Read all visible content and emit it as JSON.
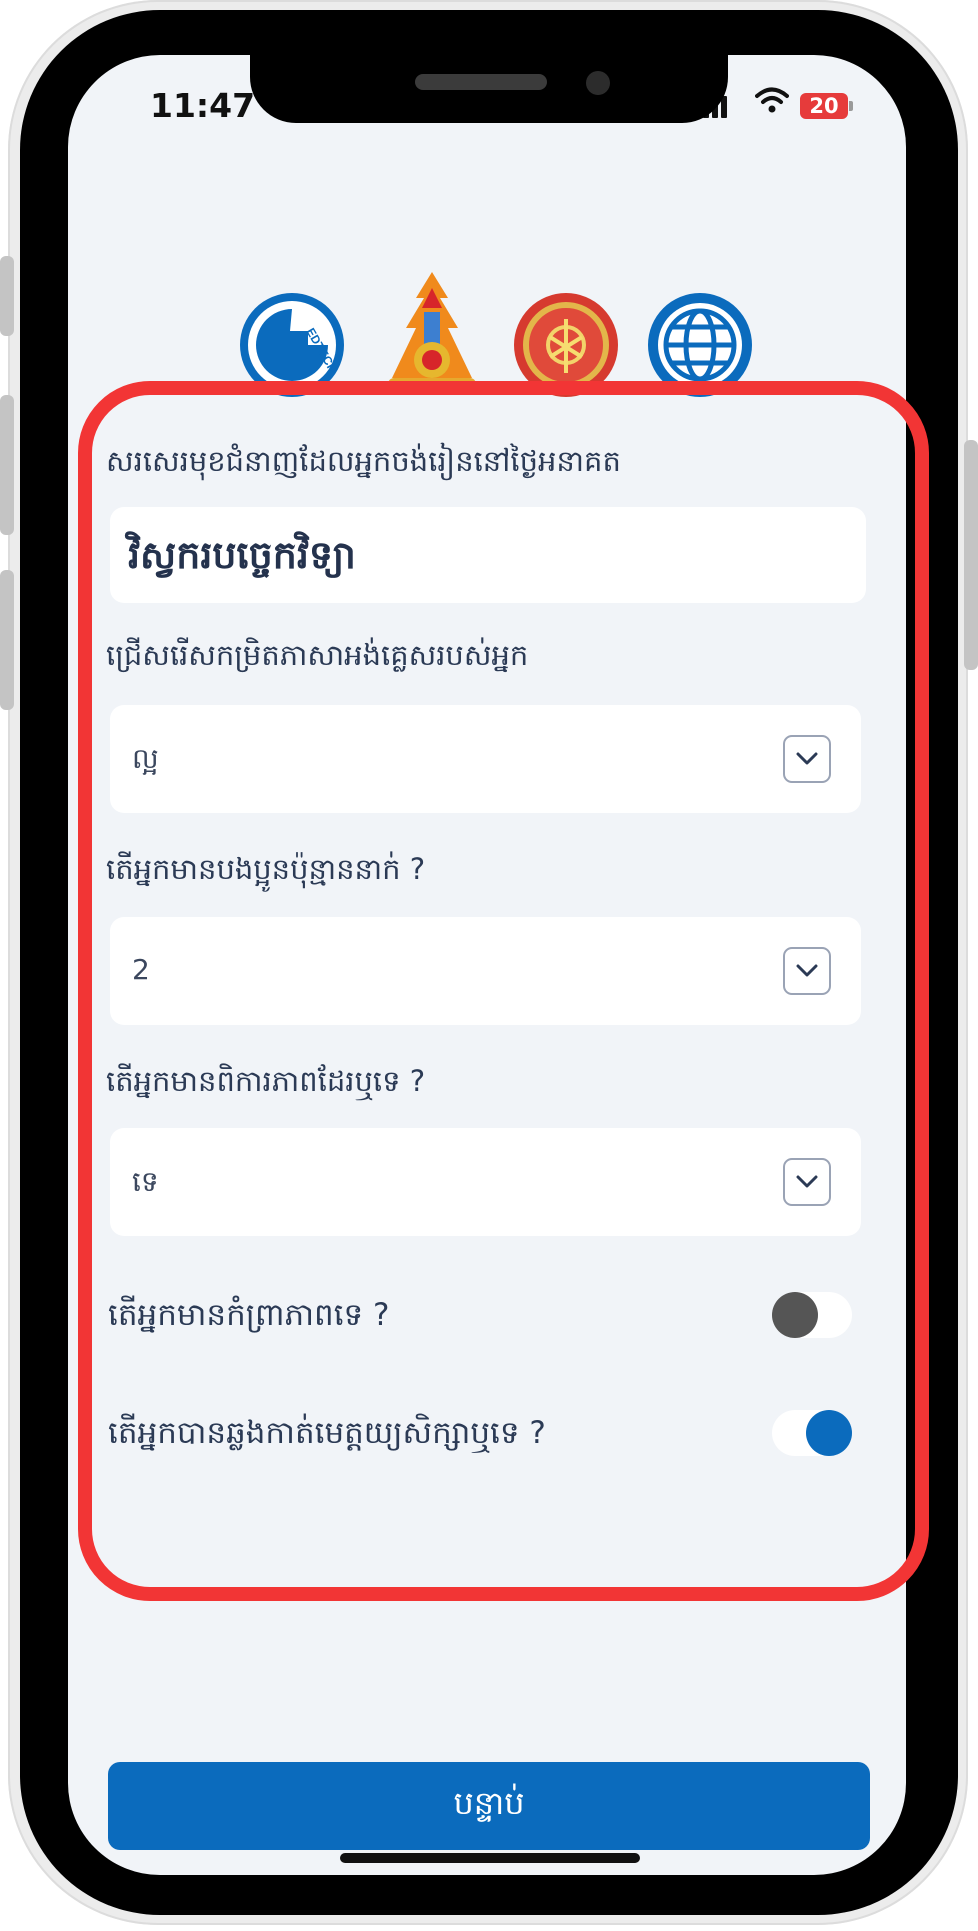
{
  "status_bar": {
    "time": "11:47",
    "battery": "20"
  },
  "logos": [
    "edtech-logo",
    "ministry-emblem",
    "partner-emblem",
    "globe-logo"
  ],
  "logo_text": "EDTECH",
  "form": {
    "dream_job": {
      "label": "សរសេរមុខជំនាញដែលអ្នកចង់រៀននៅថ្ងៃអនាគត",
      "value": "វិស្វករបច្ចេកវិទ្យា"
    },
    "english_level": {
      "label": "ជ្រើសរើសកម្រិតភាសាអង់គ្លេសរបស់អ្នក",
      "value": "ល្អ"
    },
    "siblings": {
      "label": "តើអ្នកមានបងប្អូនប៉ុន្មាននាក់ ?",
      "value": "2"
    },
    "disability": {
      "label": "តើអ្នកមានពិការភាពដែរឬទេ ?",
      "value": "ទេ"
    },
    "orphan": {
      "label": "តើអ្នកមានកំព្រាភាពទេ ?",
      "on": false
    },
    "passed_exam": {
      "label": "តើអ្នកបានឆ្លងកាត់មេត្តយ្យសិក្សាឬទេ ?",
      "on": true
    }
  },
  "next_button": "បន្ទាប់",
  "colors": {
    "accent": "#0b6bbd",
    "highlight": "#f23535",
    "toggle_off": "#555555"
  }
}
